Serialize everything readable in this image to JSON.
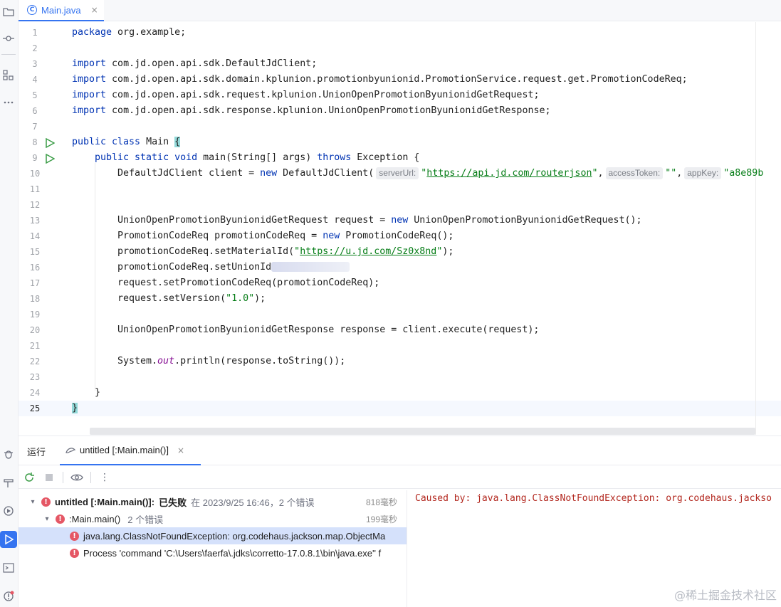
{
  "editor_tab": {
    "label": "Main.java",
    "icon": "java-class-icon",
    "close": "×"
  },
  "code": {
    "line_numbers": [
      "1",
      "2",
      "3",
      "4",
      "5",
      "6",
      "7",
      "8",
      "9",
      "10",
      "11",
      "12",
      "13",
      "14",
      "15",
      "16",
      "17",
      "18",
      "19",
      "20",
      "21",
      "22",
      "23",
      "24",
      "25"
    ],
    "l1_kw": "package",
    "l1_rest": " org.example;",
    "import_kw": "import",
    "l3_rest": " com.jd.open.api.sdk.DefaultJdClient;",
    "l4_rest": " com.jd.open.api.sdk.domain.kplunion.promotionbyunionid.PromotionService.request.get.PromotionCodeReq;",
    "l5_rest": " com.jd.open.api.sdk.request.kplunion.UnionOpenPromotionByunionidGetRequest;",
    "l6_rest": " com.jd.open.api.sdk.response.kplunion.UnionOpenPromotionByunionidGetResponse;",
    "l8_kw": "public class",
    "l8_mid": " Main ",
    "l8_brace": "{",
    "l9_kw1": "public static void",
    "l9_mid": " main(String[] args) ",
    "l9_kw2": "throws",
    "l9_end": " Exception {",
    "l10_pre": "DefaultJdClient client = ",
    "l10_new": "new",
    "l10_mid": " DefaultJdClient(",
    "l10_hint1": "serverUrl:",
    "l10_q1": "\"",
    "l10_url": "https://api.jd.com/routerjson",
    "l10_q2": "\"",
    "l10_comma1": ",",
    "l10_hint2": "accessToken:",
    "l10_str2": "\"\"",
    "l10_comma2": ",",
    "l10_hint3": "appKey:",
    "l10_str3": "\"a8e89b",
    "l13_pre": "UnionOpenPromotionByunionidGetRequest request = ",
    "l13_new": "new",
    "l13_end": " UnionOpenPromotionByunionidGetRequest();",
    "l14_pre": "PromotionCodeReq promotionCodeReq = ",
    "l14_new": "new",
    "l14_end": " PromotionCodeReq();",
    "l15_pre": "promotionCodeReq.setMaterialId(",
    "l15_q1": "\"",
    "l15_url": "https://u.jd.com/Sz0x8nd",
    "l15_q2": "\"",
    "l15_end": ");",
    "l16_pre": "promotionCodeReq.setUnionId",
    "l17": "request.setPromotionCodeReq(promotionCodeReq);",
    "l18_pre": "request.setVersion(",
    "l18_str": "\"1.0\"",
    "l18_end": ");",
    "l20": "UnionOpenPromotionByunionidGetResponse response = client.execute(request);",
    "l22_pre": "System.",
    "l22_field": "out",
    "l22_end": ".println(response.toString());",
    "l24": "}",
    "l25": "}"
  },
  "run_panel": {
    "title": "运行",
    "tab_label": "untitled [:Main.main()]",
    "tab_close": "×",
    "toolbar_more": "⋮",
    "tree": {
      "root_name": "untitled [:Main.main()]:",
      "root_status": " 已失败 ",
      "root_meta": "在 2023/9/25 16:46，2 个错误",
      "root_time": "818毫秒",
      "child_name": ":Main.main()",
      "child_meta": "2 个错误",
      "child_time": "199毫秒",
      "err1": "java.lang.ClassNotFoundException: org.codehaus.jackson.map.ObjectMa",
      "err2": "Process 'command 'C:\\Users\\faerfa\\.jdks\\corretto-17.0.8.1\\bin\\java.exe'' f"
    },
    "console_text": "Caused by: java.lang.ClassNotFoundException: org.codehaus.jackso"
  },
  "watermark": "@稀土掘金技术社区",
  "colors": {
    "accent": "#3574f0",
    "keyword": "#0033b3",
    "string": "#067d17",
    "error": "#e55765",
    "console_error": "#b2261d"
  }
}
